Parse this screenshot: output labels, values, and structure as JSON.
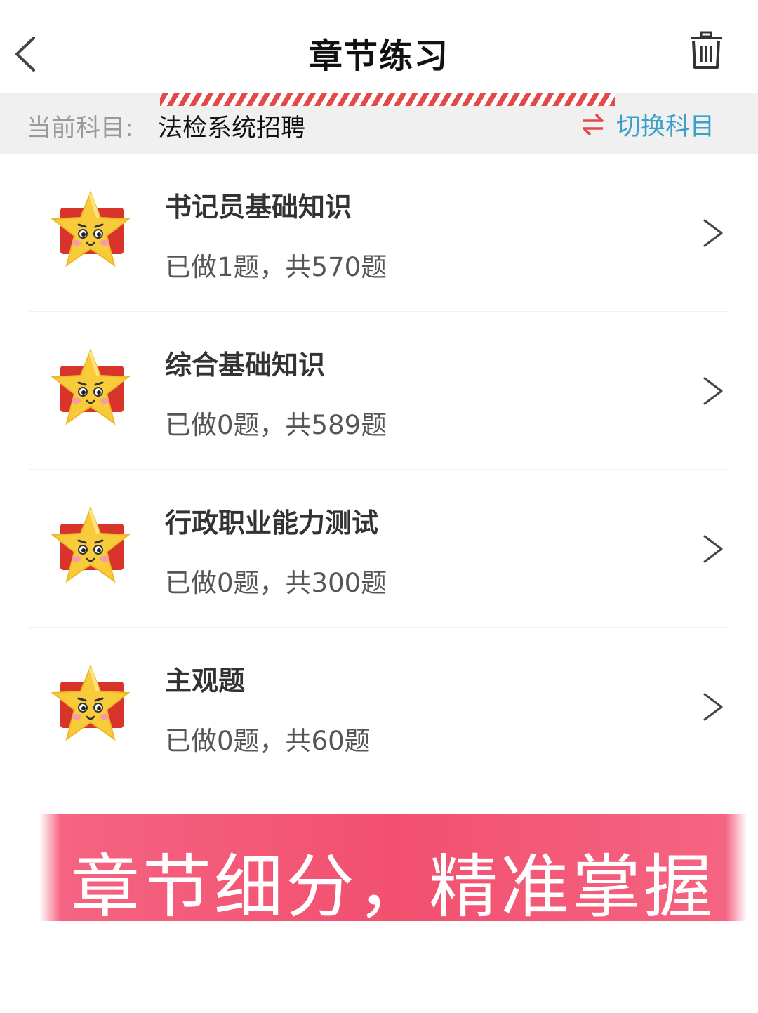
{
  "header": {
    "title": "章节练习"
  },
  "subject": {
    "label": "当前科目:",
    "name": "法检系统招聘",
    "switch_label": "切换科目"
  },
  "chapters": [
    {
      "title": "书记员基础知识",
      "progress": "已做1题，共570题",
      "done": 1,
      "total": 570
    },
    {
      "title": "综合基础知识",
      "progress": "已做0题，共589题",
      "done": 0,
      "total": 589
    },
    {
      "title": "行政职业能力测试",
      "progress": "已做0题，共300题",
      "done": 0,
      "total": 300
    },
    {
      "title": "主观题",
      "progress": "已做0题，共60题",
      "done": 0,
      "total": 60
    }
  ],
  "banner": {
    "text": "章节细分，精准掌握"
  },
  "colors": {
    "accent_blue": "#3aa0c8",
    "accent_red": "#e24a4a",
    "banner_pink": "#f2506f",
    "star_yellow": "#f7cb3a"
  },
  "icons": {
    "back": "chevron-left-icon",
    "delete": "trash-icon",
    "switch": "swap-arrows-icon",
    "chapter": "star-mascot-icon",
    "open": "chevron-right-icon"
  }
}
